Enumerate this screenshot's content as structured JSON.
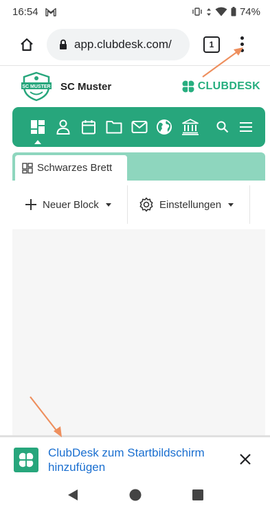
{
  "status_bar": {
    "time": "16:54",
    "battery": "74%",
    "icons": [
      "gmail-icon",
      "vibrate-icon",
      "data-arrows-icon",
      "wifi-icon",
      "battery-icon"
    ]
  },
  "browser": {
    "url": "app.clubdesk.com/",
    "tab_count": "1",
    "icons": [
      "home-icon",
      "lock-icon",
      "tabs-icon",
      "menu-dots-icon"
    ]
  },
  "header": {
    "club_name": "SC Muster",
    "logo_text": "SC MUSTER",
    "brand": "CLUBDESK"
  },
  "nav": {
    "icons": [
      "dashboard-icon",
      "person-icon",
      "calendar-icon",
      "folder-icon",
      "mail-icon",
      "globe-icon",
      "bank-icon",
      "search-icon",
      "hamburger-icon"
    ],
    "active": "dashboard-icon",
    "color": "#27a67c"
  },
  "tabs": [
    {
      "label": "Schwarzes Brett",
      "active": true
    }
  ],
  "toolbar": {
    "new_block": "Neuer Block",
    "settings": "Einstellungen"
  },
  "banner": {
    "text": "ClubDesk zum Startbildschirm hinzufügen"
  },
  "colors": {
    "brand_green": "#27a67c",
    "tab_strip": "#8ed6be",
    "link_blue": "#1a6fd0",
    "annotation": "#ee8f5e"
  },
  "android_nav": [
    "back-icon",
    "home-circle-icon",
    "recents-icon"
  ]
}
